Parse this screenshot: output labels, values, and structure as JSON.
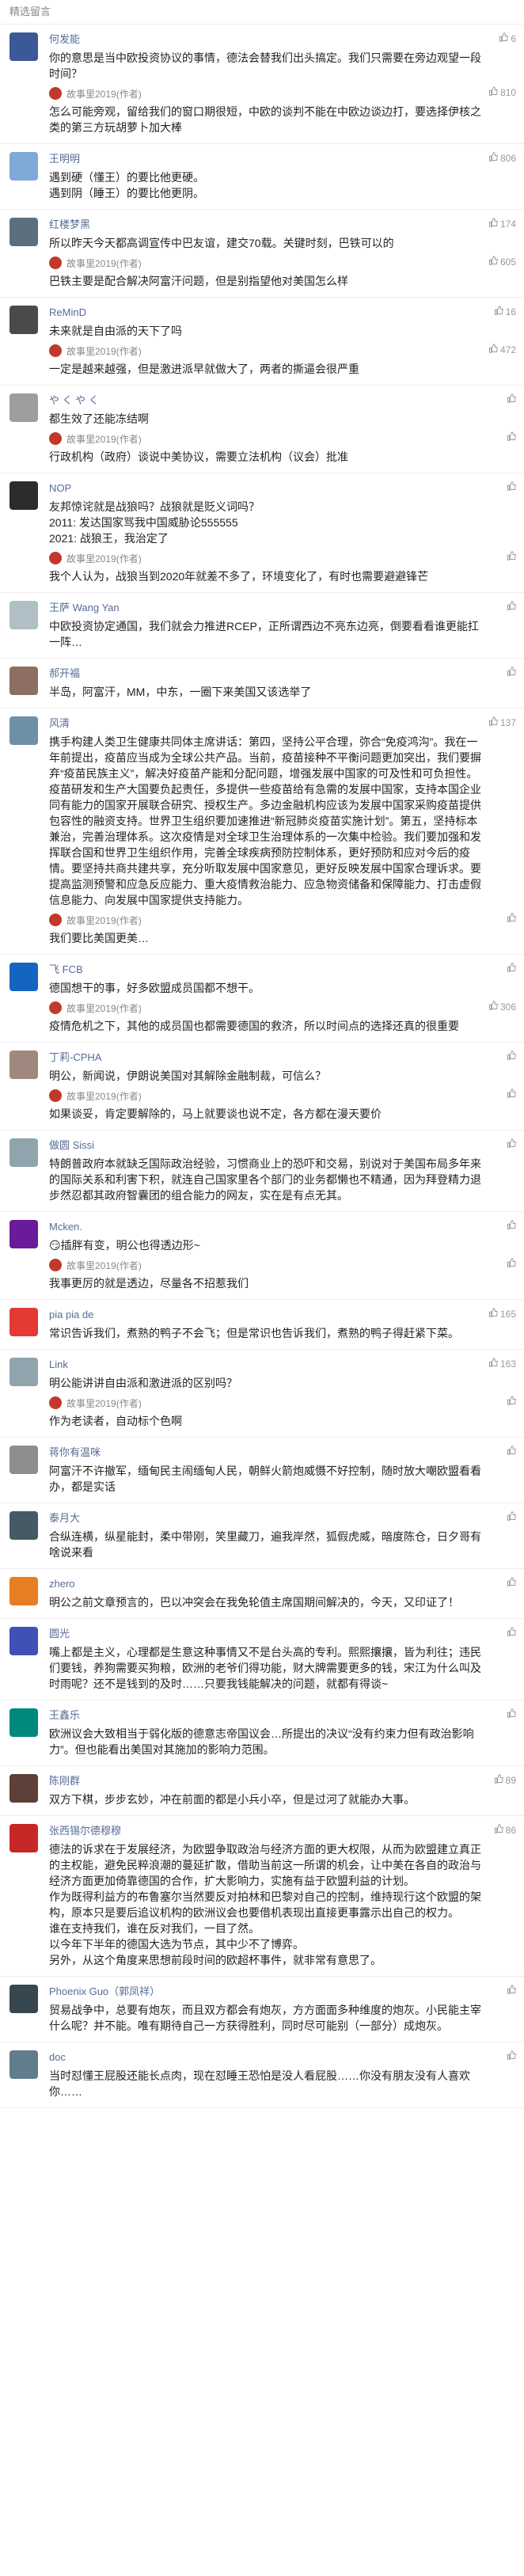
{
  "header": {
    "title": "精选留言"
  },
  "author_name": "故事里2019(作者)",
  "comments": [
    {
      "name": "何发能",
      "avatar_color": "#3b5998",
      "likes": "6",
      "text": "你的意思是当中欧投资协议的事情，德法会替我们出头搞定。我们只需要在旁边观望一段时间？",
      "reply": {
        "likes": "810",
        "text": "怎么可能旁观，留给我们的窗口期很短，中欧的谈判不能在中欧边谈边打，要选择伊核之类的第三方玩胡萝卜加大棒"
      }
    },
    {
      "name": "王明明",
      "avatar_color": "#7fa9d6",
      "likes": "806",
      "text": "遇到硬（懂王）的要比他更硬。\n遇到阴（睡王）的要比他更阴。",
      "reply": null
    },
    {
      "name": "红楼梦黑",
      "avatar_color": "#5c6f7e",
      "likes": "174",
      "text": "所以昨天今天都高调宣传中巴友谊，建交70载。关键时刻，巴铁可以的",
      "reply": {
        "likes": "605",
        "text": "巴铁主要是配合解决阿富汗问题，但是别指望他对美国怎么样"
      }
    },
    {
      "name": "ReMinD",
      "avatar_color": "#4a4a4a",
      "likes": "16",
      "text": "未来就是自由派的天下了吗",
      "reply": {
        "likes": "472",
        "text": "一定是越来越强，但是激进派早就做大了，两者的撕逼会很严重"
      }
    },
    {
      "name": "や く や く",
      "avatar_color": "#9e9e9e",
      "likes": "",
      "text": "都生效了还能冻结啊",
      "reply": {
        "likes": "",
        "text": "行政机构（政府）谈说中美协议，需要立法机构（议会）批准"
      }
    },
    {
      "name": "NOP",
      "avatar_color": "#2c2c2c",
      "likes": "",
      "text": "友邦惊诧就是战狼吗？战狼就是贬义词吗？\n2011: 发达国家骂我中国威胁论555555\n2021: 战狼王，我治定了",
      "reply": {
        "likes": "",
        "text": "我个人认为，战狼当到2020年就差不多了，环境变化了，有时也需要避避锋芒"
      }
    },
    {
      "name": "王萨 Wang Yan",
      "avatar_color": "#b0bec5",
      "likes": "",
      "text": "中欧投资协定通国，我们就会力推进RCEP，正所谓西边不亮东边亮，倒要看看谁更能扛一阵…",
      "reply": null
    },
    {
      "name": "郝开福",
      "avatar_color": "#8d6e63",
      "likes": "",
      "text": "半岛，阿富汗，MM，中东，一圈下来美国又该选举了",
      "reply": null
    },
    {
      "name": "风清",
      "avatar_color": "#6d8fa8",
      "likes": "137",
      "text": "携手构建人类卫生健康共同体主席讲话：第四，坚持公平合理，弥合“免疫鸿沟”。我在一年前提出，疫苗应当成为全球公共产品。当前，疫苗接种不平衡问题更加突出，我们要摒弃“疫苗民族主义”，解决好疫苗产能和分配问题，增强发展中国家的可及性和可负担性。疫苗研发和生产大国要负起责任，多提供一些疫苗给有急需的发展中国家，支持本国企业同有能力的国家开展联合研究、授权生产。多边金融机构应该为发展中国家采购疫苗提供包容性的融资支持。世界卫生组织要加速推进“新冠肺炎疫苗实施计划”。第五，坚持标本兼治，完善治理体系。这次疫情是对全球卫生治理体系的一次集中检验。我们要加强和发挥联合国和世界卫生组织作用，完善全球疾病预防控制体系，更好预防和应对今后的疫情。要坚持共商共建共享，充分听取发展中国家意见，更好反映发展中国家合理诉求。要提高监测预警和应急反应能力、重大疫情救治能力、应急物资储备和保障能力、打击虚假信息能力、向发展中国家提供支持能力。",
      "reply": {
        "likes": "",
        "text": "我们要比美国更美…"
      }
    },
    {
      "name": "飞 FCB",
      "avatar_color": "#1565c0",
      "likes": "",
      "text": "德国想干的事，好多欧盟成员国都不想干。",
      "reply": {
        "likes": "306",
        "text": "疫情危机之下，其他的成员国也都需要德国的救济，所以时间点的选择还真的很重要"
      }
    },
    {
      "name": "丁莉-CPHA",
      "avatar_color": "#a1887f",
      "likes": "",
      "text": "明公，新闻说，伊朗说美国对其解除金融制裁，可信么？",
      "reply": {
        "likes": "",
        "text": "如果谈妥，肯定要解除的，马上就要谈也说不定，各方都在漫天要价"
      }
    },
    {
      "name": "做圆 Sissi",
      "avatar_color": "#90a4ae",
      "likes": "",
      "text": "特朗普政府本就缺乏国际政治经验，习惯商业上的恐吓和交易，别说对于美国布局多年来的国际关系和利害下积，就连自己国家里各个部门的业务都懒也不精通，因为拜登精力退步然忍都其政府智囊团的组合能力的网友，实在是有点无其。",
      "reply": null
    },
    {
      "name": "Mcken.",
      "avatar_color": "#6a1b9a",
      "likes": "",
      "text": "😏插胖有变，明公也得透边形~",
      "reply": {
        "likes": "",
        "text": "我事更厉的就是透边，尽量各不招惹我们"
      }
    },
    {
      "name": "pia pia de",
      "avatar_color": "#e53935",
      "likes": "165",
      "text": "常识告诉我们，煮熟的鸭子不会飞；但是常识也告诉我们，煮熟的鸭子得赶紧下菜。",
      "reply": null
    },
    {
      "name": "Link",
      "avatar_color": "#90a4ae",
      "likes": "163",
      "text": "明公能讲讲自由派和激进派的区别吗？",
      "reply": {
        "likes": "",
        "text": "作为老读者，自动标个色啊"
      }
    },
    {
      "name": "蒋你有温咪",
      "avatar_color": "#8e8e8e",
      "likes": "",
      "text": "阿富汗不许撤军，缅甸民主闹缅甸人民，朝鲜火箭炮威慑不好控制，随时放大嘲欧盟看看办，都是实话",
      "reply": null
    },
    {
      "name": "泰月大",
      "avatar_color": "#455a64",
      "likes": "",
      "text": "合纵连横，纵星能封，柔中带刚，笑里藏刀，遍我岸然，狐假虎威，暗度陈仓，日夕哥有啥说来看",
      "reply": null
    },
    {
      "name": "zhero",
      "avatar_color": "#e67e22",
      "likes": "",
      "text": "明公之前文章预言的，巴以冲突会在我免轮值主席国期间解决的，今天，又印证了！",
      "reply": null
    },
    {
      "name": "圆光",
      "avatar_color": "#3f51b5",
      "likes": "",
      "text": "嘴上都是主义，心理都是生意这种事情又不是台头高的专利。熙熙攘攘，皆为利往；违民们要钱，养狗需要买狗粮，欧洲的老爷们得功能，财大牌需要更多的钱，宋江为什么叫及时雨呢？还不是钱到的及时……只要我钱能解决的问题，就都有得谈~",
      "reply": null
    },
    {
      "name": "王鑫乐",
      "avatar_color": "#00897b",
      "likes": "",
      "text": "欧洲议会大致相当于弱化版的德意志帝国议会…所提出的决议“没有约束力但有政治影响力”。但也能看出美国对其施加的影响力范围。",
      "reply": null
    },
    {
      "name": "陈刚群",
      "avatar_color": "#5d4037",
      "likes": "89",
      "text": "双方下棋，步步玄妙，冲在前面的都是小兵小卒，但是过河了就能办大事。",
      "reply": null
    },
    {
      "name": "张西锡尔德穆穆",
      "avatar_color": "#c62828",
      "likes": "86",
      "text": "德法的诉求在于发展经济，为欧盟争取政治与经济方面的更大权限，从而为欧盟建立真正的主权能，避免民粹浪潮的蔓延扩散，借助当前这一所谓的机会，让中美在各自的政治与经济方面更加倚靠德国的合作，扩大影响力，实施有益于欧盟利益的计划。\n作为既得利益方的布鲁塞尔当然要反对拍林和巴黎对自己的控制，维持现行这个欧盟的架构，原本只是要后追议机构的欧洲议会也要借机表现出直接更事露示出自己的权力。\n谁在支持我们，谁在反对我们，一目了然。\n以今年下半年的德国大选为节点，其中少不了博弈。\n另外，从这个角度来思想前段时间的欧超杯事件，就非常有意思了。",
      "reply": null
    },
    {
      "name": "Phoenix Guo（郭凤祥）",
      "avatar_color": "#37474f",
      "likes": "",
      "text": "贸易战争中，总要有炮灰，而且双方都会有炮灰，方方面面多种维度的炮灰。小民能主宰什么呢？并不能。唯有期待自己一方获得胜利，同时尽可能别（一部分）成炮灰。",
      "reply": null
    },
    {
      "name": "doc",
      "avatar_color": "#607d8b",
      "likes": "",
      "text": "当时怼懂王屁股还能长点肉，现在怼睡王恐怕是没人看屁股……你没有朋友没有人喜欢你……",
      "reply": null
    }
  ]
}
